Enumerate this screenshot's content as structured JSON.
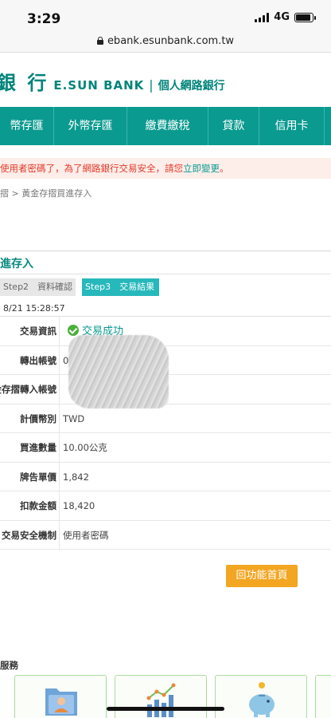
{
  "status_bar": {
    "time": "3:29",
    "network": "4G"
  },
  "browser": {
    "url": "ebank.esunbank.com.tw"
  },
  "header": {
    "brand_cn": "銀 行",
    "brand_en": "E.SUN BANK",
    "separator": "|",
    "subtitle": "個人網路銀行"
  },
  "nav": {
    "items": [
      "幣存匯",
      "外幣存匯",
      "繳費繳稅",
      "貸款",
      "信用卡"
    ]
  },
  "notice": {
    "text": "使用者密碼了，為了網路銀行交易安全，請您",
    "link": "立即變更",
    "tail": "。"
  },
  "breadcrumb": "摺 > 黃金存摺買進存入",
  "page_title": "進存入",
  "steps": {
    "step2": "Step2　資料確認",
    "step3": "Step3　交易結果"
  },
  "timestamp": "8/21 15:28:57",
  "details": {
    "rows": [
      {
        "label": "交易資訊",
        "value": "交易成功"
      },
      {
        "label": "轉出帳號",
        "value": "0"
      },
      {
        "label": "金存摺轉入帳號",
        "value": ""
      },
      {
        "label": "計價幣別",
        "value": "TWD"
      },
      {
        "label": "買進數量",
        "value": "10.00公克"
      },
      {
        "label": "牌告單價",
        "value": "1,842"
      },
      {
        "label": "扣款金額",
        "value": "18,420"
      },
      {
        "label": "交易安全機制",
        "value": "使用者密碼"
      }
    ]
  },
  "buttons": {
    "home": "回功能首頁"
  },
  "services": {
    "title": "服務"
  },
  "colors": {
    "brand": "#00847a",
    "nav": "#0a9a8f",
    "step_active": "#27b8bb",
    "button": "#f3a622",
    "notice": "#e23b2a"
  }
}
